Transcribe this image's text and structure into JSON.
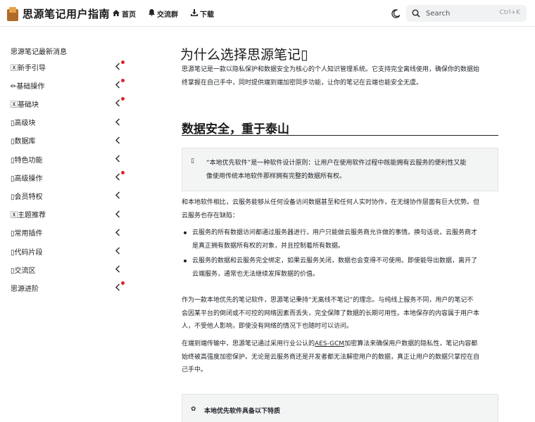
{
  "header": {
    "title": "思源笔记用户指南",
    "nav": [
      {
        "label": "首页",
        "icon": "home-icon"
      },
      {
        "label": "交流群",
        "icon": "bell-icon"
      },
      {
        "label": "下载",
        "icon": "download-icon"
      }
    ],
    "search": {
      "placeholder": "Search",
      "shortcut": "Ctrl+K"
    }
  },
  "sidebar": {
    "latest": "思源笔记最新消息",
    "items": [
      {
        "label": "🅇新手引导",
        "badge": true
      },
      {
        "label": "✏基础操作",
        "badge": true
      },
      {
        "label": "🅇基础块",
        "badge": true
      },
      {
        "label": "▯高级块",
        "badge": false
      },
      {
        "label": "▯数据库",
        "badge": false
      },
      {
        "label": "▯特色功能",
        "badge": false
      },
      {
        "label": "▯高级操作",
        "badge": true
      },
      {
        "label": "▯会员特权",
        "badge": false
      },
      {
        "label": "🅇主题推荐",
        "badge": false
      },
      {
        "label": "▯常用插件",
        "badge": false
      },
      {
        "label": "▯代码片段",
        "badge": false
      },
      {
        "label": "▯交流区",
        "badge": false
      },
      {
        "label": "思源进阶",
        "badge": true
      }
    ]
  },
  "main": {
    "title": "为什么选择思源笔记▯",
    "intro_1": "思源笔记是一款以隐私保护和数据安全为核心的个人知识管理系统。它支持完全离线使用，确保你的数据始",
    "intro_2": "终掌握在自己手中，同时提供端到端加密同步功能，让你的笔记在云端也能安全无虞。",
    "h2": "数据安全，重于泰山",
    "callout_icon": "▯",
    "callout_1": "“本地优先软件”是一种软件设计原则：让用户在使用软件过程中既能拥有云服务的便利性又能",
    "callout_2": "像使用传统本地软件那样拥有完整的数据所有权。",
    "para2_1": "和本地软件相比，云服务能够从任何设备访问数据甚至和任何人实时协作，在无缝协作层面有巨大优势。但",
    "para2_2": "云服务也存在缺陷：",
    "bullets": [
      {
        "l1": "云服务的所有数据访问都通过服务器进行，用户只能做云服务商允许做的事情。换句话说，云服务商才",
        "l2": "是真正拥有数据所有权的对象，并且控制着所有数据。"
      },
      {
        "l1": "云服务的数据和云服务完全绑定，如果云服务关闭，数据也会变得不可使用。即使能导出数据，离开了",
        "l2": "云端服务，通常也无法继续发挥数据的价值。"
      }
    ],
    "para3_1": "作为一款本地优先的笔记软件，思源笔记秉持“无离线不笔记”的理念。与纯线上服务不同，用户的笔记不",
    "para3_2": "会因某平台的倒闭或不可控的网络因素而丢失，完全保障了数据的长期可用性。本地保存的内容属于用户本",
    "para3_3": "人，不受他人影响，即使没有网络的情况下也随时可以访问。",
    "para4_pre": "在端到端传输中，思源笔记通过采用行业公认的",
    "para4_link": "AES-GCM",
    "para4_post": "加密算法来确保用户数据的隐私性，笔记内容都",
    "para4_2": "始终被高强度加密保护。无论是云服务商还是开发者都无法解密用户的数据，真正让用户的数据只掌控在自",
    "para4_3": "己手中。",
    "callout2_icon": "✿",
    "callout2_title": "本地优先软件具备以下特质"
  }
}
